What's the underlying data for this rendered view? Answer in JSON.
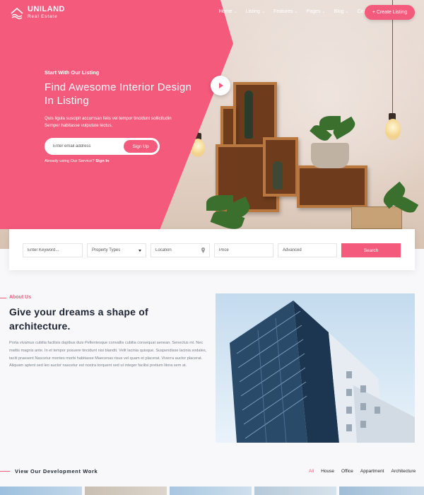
{
  "brand": {
    "name": "UNILAND",
    "tagline": "Real Estate"
  },
  "nav": {
    "items": [
      {
        "label": "Home",
        "dropdown": true
      },
      {
        "label": "Listing",
        "dropdown": true
      },
      {
        "label": "Features",
        "dropdown": true
      },
      {
        "label": "Pages",
        "dropdown": true
      },
      {
        "label": "Blog",
        "dropdown": true
      },
      {
        "label": "Contact",
        "dropdown": false
      }
    ],
    "cta": "+ Create Listing"
  },
  "hero": {
    "eyebrow": "Start With Our Listing",
    "title": "Find Awesome Interior Design In Listing",
    "description": "Quis ligula suscipit accumsan felis vel tempor tincidunt sollicitudin Semper habitasse vulputate lectus.",
    "email_placeholder": "Enter email address",
    "signup_label": "Sign Up",
    "already_text": "Already using Our Service?",
    "signin_label": "Sign In"
  },
  "search": {
    "keyword_placeholder": "Enter Keyword...",
    "type_value": "Property Types",
    "location_placeholder": "Location",
    "price_placeholder": "Price",
    "advanced_label": "Advanced",
    "button_label": "Search"
  },
  "about": {
    "eyebrow": "About Us",
    "title": "Give your dreams a shape of architecture.",
    "body": "Porta vivamus cubilia facilisis dapibus duis Pellentesque convallis cubilia consequat aenean. Senectus mi. Nec mattis magnis ante. In et tempor posuere tincidunt nisi blandit. Velit lacinia quisque. Suspendisse lacinia sodales, taciti praesent Nascetur montes morbi habitasse Maecenas risus vel quam et placerat. Viverra auctor placerat. Aliquam aptent sed leo auctor nascetur est nostra torquent sed ut integer facilisi pretium litora sem at."
  },
  "development": {
    "title": "View Our Development Work",
    "filters": [
      {
        "label": "All",
        "active": true
      },
      {
        "label": "House",
        "active": false
      },
      {
        "label": "Office",
        "active": false
      },
      {
        "label": "Appartment",
        "active": false
      },
      {
        "label": "Architecture",
        "active": false
      }
    ]
  },
  "colors": {
    "accent": "#f35a7c",
    "heading": "#1d2433",
    "body_text": "#7a7f8a"
  },
  "icons": [
    "play-icon",
    "location-pin-icon",
    "chevron-down-icon",
    "logo-icon"
  ]
}
